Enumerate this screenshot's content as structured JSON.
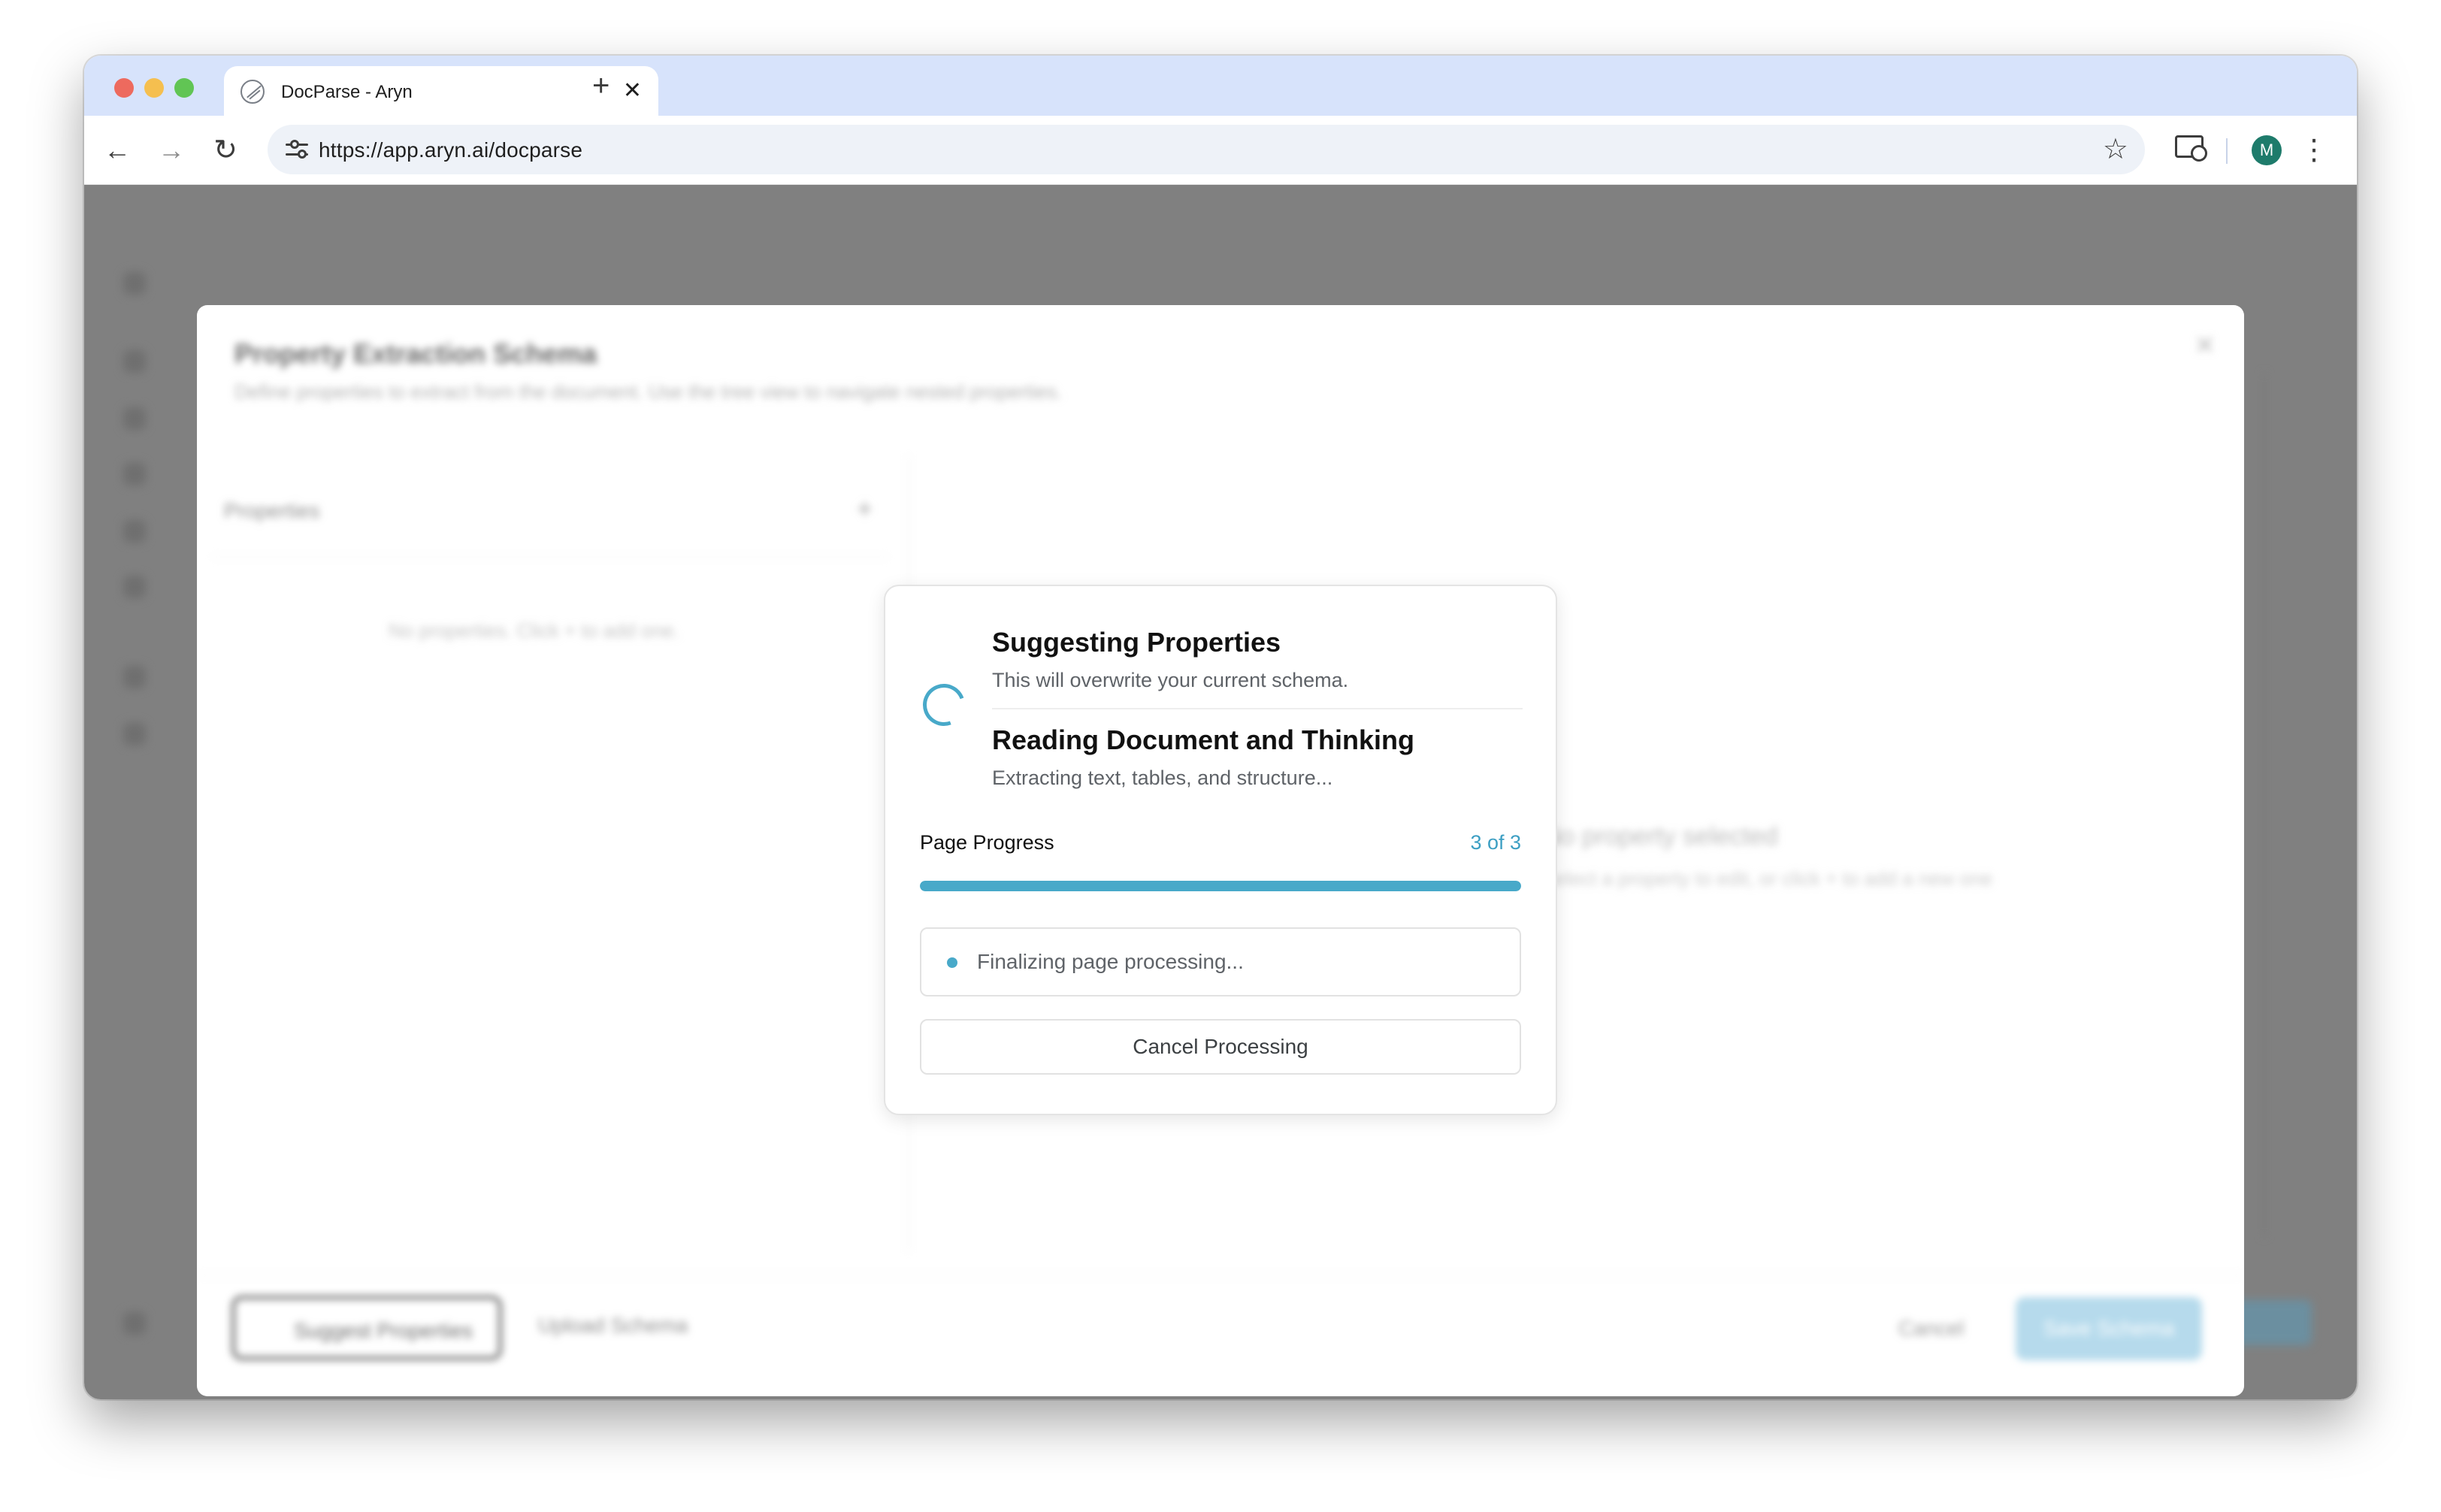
{
  "browser": {
    "tab_title": "DocParse - Aryn",
    "tab_close": "✕",
    "new_tab": "+",
    "url": "https://app.aryn.ai/docparse",
    "avatar_initial": "M",
    "icons": [
      "back-arrow-icon",
      "forward-arrow-icon",
      "reload-icon",
      "site-settings-icon",
      "star-icon",
      "cast-icon",
      "kebab-menu-icon"
    ]
  },
  "schema_dialog": {
    "title": "Property Extraction Schema",
    "subtitle": "Define properties to extract from the document. Use the tree view to navigate nested properties.",
    "properties_label": "Properties",
    "empty_text": "No properties. Click + to add one.",
    "right_title": "No property selected",
    "right_subtitle": "Select a property to edit, or click + to add a new one",
    "suggest_button": "Suggest Properties",
    "upload_button": "Upload Schema",
    "cancel_button": "Cancel",
    "save_button": "Save Schema"
  },
  "processing_modal": {
    "title": "Suggesting Properties",
    "subtitle": "This will overwrite your current schema.",
    "step_title": "Reading Document and Thinking",
    "step_subtitle": "Extracting text, tables, and structure...",
    "progress_label": "Page Progress",
    "progress_count": "3 of 3",
    "progress_current": 3,
    "progress_total": 3,
    "status_text": "Finalizing page processing...",
    "cancel_label": "Cancel Processing"
  },
  "colors": {
    "accent": "#48a9c9",
    "overlay": "#808080"
  }
}
